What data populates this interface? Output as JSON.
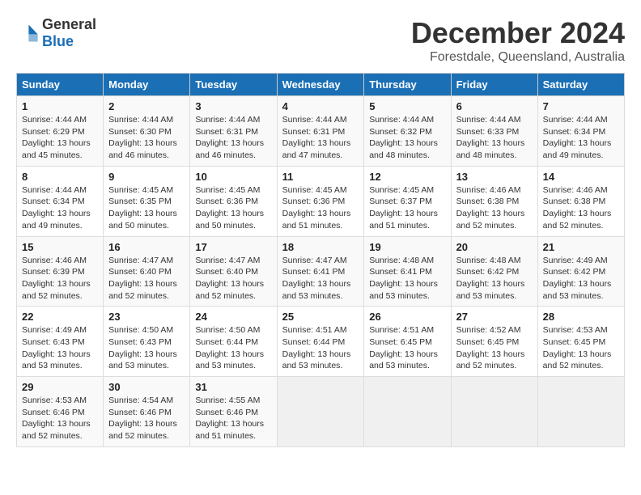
{
  "logo": {
    "general": "General",
    "blue": "Blue"
  },
  "title": "December 2024",
  "location": "Forestdale, Queensland, Australia",
  "days_of_week": [
    "Sunday",
    "Monday",
    "Tuesday",
    "Wednesday",
    "Thursday",
    "Friday",
    "Saturday"
  ],
  "weeks": [
    [
      {
        "day": "1",
        "info": "Sunrise: 4:44 AM\nSunset: 6:29 PM\nDaylight: 13 hours and 45 minutes."
      },
      {
        "day": "2",
        "info": "Sunrise: 4:44 AM\nSunset: 6:30 PM\nDaylight: 13 hours and 46 minutes."
      },
      {
        "day": "3",
        "info": "Sunrise: 4:44 AM\nSunset: 6:31 PM\nDaylight: 13 hours and 46 minutes."
      },
      {
        "day": "4",
        "info": "Sunrise: 4:44 AM\nSunset: 6:31 PM\nDaylight: 13 hours and 47 minutes."
      },
      {
        "day": "5",
        "info": "Sunrise: 4:44 AM\nSunset: 6:32 PM\nDaylight: 13 hours and 48 minutes."
      },
      {
        "day": "6",
        "info": "Sunrise: 4:44 AM\nSunset: 6:33 PM\nDaylight: 13 hours and 48 minutes."
      },
      {
        "day": "7",
        "info": "Sunrise: 4:44 AM\nSunset: 6:34 PM\nDaylight: 13 hours and 49 minutes."
      }
    ],
    [
      {
        "day": "8",
        "info": "Sunrise: 4:44 AM\nSunset: 6:34 PM\nDaylight: 13 hours and 49 minutes."
      },
      {
        "day": "9",
        "info": "Sunrise: 4:45 AM\nSunset: 6:35 PM\nDaylight: 13 hours and 50 minutes."
      },
      {
        "day": "10",
        "info": "Sunrise: 4:45 AM\nSunset: 6:36 PM\nDaylight: 13 hours and 50 minutes."
      },
      {
        "day": "11",
        "info": "Sunrise: 4:45 AM\nSunset: 6:36 PM\nDaylight: 13 hours and 51 minutes."
      },
      {
        "day": "12",
        "info": "Sunrise: 4:45 AM\nSunset: 6:37 PM\nDaylight: 13 hours and 51 minutes."
      },
      {
        "day": "13",
        "info": "Sunrise: 4:46 AM\nSunset: 6:38 PM\nDaylight: 13 hours and 52 minutes."
      },
      {
        "day": "14",
        "info": "Sunrise: 4:46 AM\nSunset: 6:38 PM\nDaylight: 13 hours and 52 minutes."
      }
    ],
    [
      {
        "day": "15",
        "info": "Sunrise: 4:46 AM\nSunset: 6:39 PM\nDaylight: 13 hours and 52 minutes."
      },
      {
        "day": "16",
        "info": "Sunrise: 4:47 AM\nSunset: 6:40 PM\nDaylight: 13 hours and 52 minutes."
      },
      {
        "day": "17",
        "info": "Sunrise: 4:47 AM\nSunset: 6:40 PM\nDaylight: 13 hours and 52 minutes."
      },
      {
        "day": "18",
        "info": "Sunrise: 4:47 AM\nSunset: 6:41 PM\nDaylight: 13 hours and 53 minutes."
      },
      {
        "day": "19",
        "info": "Sunrise: 4:48 AM\nSunset: 6:41 PM\nDaylight: 13 hours and 53 minutes."
      },
      {
        "day": "20",
        "info": "Sunrise: 4:48 AM\nSunset: 6:42 PM\nDaylight: 13 hours and 53 minutes."
      },
      {
        "day": "21",
        "info": "Sunrise: 4:49 AM\nSunset: 6:42 PM\nDaylight: 13 hours and 53 minutes."
      }
    ],
    [
      {
        "day": "22",
        "info": "Sunrise: 4:49 AM\nSunset: 6:43 PM\nDaylight: 13 hours and 53 minutes."
      },
      {
        "day": "23",
        "info": "Sunrise: 4:50 AM\nSunset: 6:43 PM\nDaylight: 13 hours and 53 minutes."
      },
      {
        "day": "24",
        "info": "Sunrise: 4:50 AM\nSunset: 6:44 PM\nDaylight: 13 hours and 53 minutes."
      },
      {
        "day": "25",
        "info": "Sunrise: 4:51 AM\nSunset: 6:44 PM\nDaylight: 13 hours and 53 minutes."
      },
      {
        "day": "26",
        "info": "Sunrise: 4:51 AM\nSunset: 6:45 PM\nDaylight: 13 hours and 53 minutes."
      },
      {
        "day": "27",
        "info": "Sunrise: 4:52 AM\nSunset: 6:45 PM\nDaylight: 13 hours and 52 minutes."
      },
      {
        "day": "28",
        "info": "Sunrise: 4:53 AM\nSunset: 6:45 PM\nDaylight: 13 hours and 52 minutes."
      }
    ],
    [
      {
        "day": "29",
        "info": "Sunrise: 4:53 AM\nSunset: 6:46 PM\nDaylight: 13 hours and 52 minutes."
      },
      {
        "day": "30",
        "info": "Sunrise: 4:54 AM\nSunset: 6:46 PM\nDaylight: 13 hours and 52 minutes."
      },
      {
        "day": "31",
        "info": "Sunrise: 4:55 AM\nSunset: 6:46 PM\nDaylight: 13 hours and 51 minutes."
      },
      null,
      null,
      null,
      null
    ]
  ]
}
